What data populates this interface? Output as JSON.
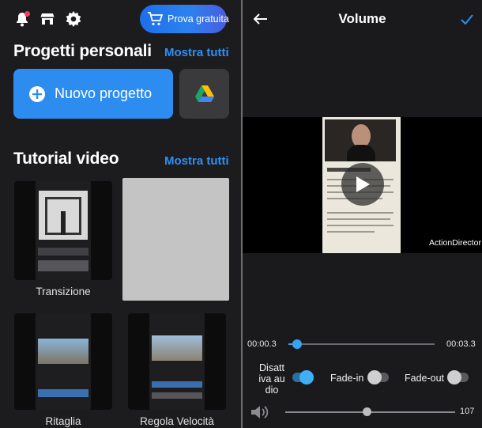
{
  "left_screen": {
    "top_bar": {
      "icons": [
        "bell-icon",
        "store-icon",
        "gear-icon"
      ],
      "trial_button_label": "Prova gratuita",
      "trial_icon": "cart-icon"
    },
    "projects": {
      "title": "Progetti personali",
      "see_all": "Mostra tutti",
      "new_project_label": "Nuovo progetto",
      "drive_icon": "google-drive-icon"
    },
    "tutorials": {
      "title": "Tutorial video",
      "see_all": "Mostra tutti",
      "items": [
        {
          "label": "Transizione"
        },
        {
          "label": ""
        },
        {
          "label": "Ritaglia"
        },
        {
          "label": "Regola Velocità"
        }
      ]
    }
  },
  "right_screen": {
    "title": "Volume",
    "back_icon": "back-arrow-icon",
    "confirm_icon": "checkmark-icon",
    "watermark": "ActionDirector",
    "timeline": {
      "start_time": "00:00.3",
      "end_time": "00:03.3",
      "position": 0.06
    },
    "options": {
      "mute_label": "Disattiva audio",
      "mute_on": true,
      "fade_in_label": "Fade-in",
      "fade_in_on": false,
      "fade_out_label": "Fade-out",
      "fade_out_on": false
    },
    "volume": {
      "icon": "speaker-icon",
      "value": "107",
      "level": 0.48
    }
  },
  "colors": {
    "accent": "#2f8ff5",
    "primary_button": "#2d8cf0",
    "slider": "#36a3f0",
    "background": "#1c1c1e"
  }
}
